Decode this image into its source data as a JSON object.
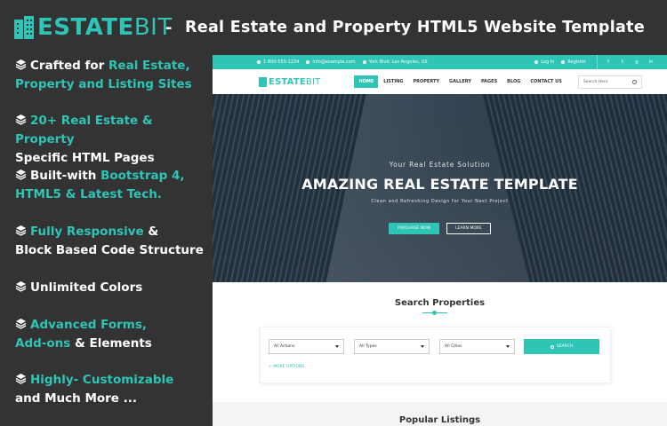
{
  "banner": {
    "brand_part1": "ESTATE",
    "brand_part2": "BIT",
    "dash": "-",
    "title": "Real Estate and Property HTML5 Website Template"
  },
  "features": [
    {
      "icon": "layers-icon",
      "parts": [
        {
          "text": "Crafted for ",
          "hl": false
        },
        {
          "text": "Real Estate,",
          "hl": true
        }
      ],
      "line2": [
        {
          "text": "Property and Listing Sites",
          "hl": true
        }
      ]
    },
    {
      "icon": "layers-icon",
      "parts": [
        {
          "text": "20+ Real Estate & Property",
          "hl": true
        }
      ],
      "line2": [
        {
          "text": "Specific HTML Pages",
          "hl": false
        }
      ]
    },
    {
      "icon": "layers-icon",
      "parts": [
        {
          "text": "Built-with ",
          "hl": false
        },
        {
          "text": "Bootstrap 4,",
          "hl": true
        }
      ],
      "line2": [
        {
          "text": "HTML5 & Latest Tech.",
          "hl": true
        }
      ]
    },
    {
      "icon": "layers-icon",
      "parts": [
        {
          "text": "Fully Responsive",
          "hl": true
        },
        {
          "text": " &",
          "hl": false
        }
      ],
      "line2": [
        {
          "text": "Block Based Code Structure",
          "hl": false
        }
      ]
    },
    {
      "icon": "layers-icon",
      "parts": [
        {
          "text": "Unlimited Colors",
          "hl": false
        }
      ],
      "line2": []
    },
    {
      "icon": "layers-icon",
      "parts": [
        {
          "text": "Advanced Forms,",
          "hl": true
        }
      ],
      "line2": [
        {
          "text": "Add-ons",
          "hl": true
        },
        {
          "text": " & Elements",
          "hl": false
        }
      ]
    },
    {
      "icon": "layers-icon",
      "parts": [
        {
          "text": "Highly- Customizable",
          "hl": true
        }
      ],
      "line2": [
        {
          "text": "and Much More ...",
          "hl": false
        }
      ]
    }
  ],
  "mock": {
    "topbar": {
      "phone": "1-800-555-1234",
      "email": "info@example.com",
      "address": "York Blvd, Los Angeles, US",
      "login": "Log In",
      "register": "Register",
      "social": [
        "f",
        "t",
        "g",
        "in"
      ]
    },
    "nav": {
      "logo_part1": "ESTATE",
      "logo_part2": "BIT",
      "items": [
        "HOME",
        "LISTING",
        "PROPERTY",
        "GALLERY",
        "PAGES",
        "BLOG",
        "CONTACT US"
      ],
      "active_index": 0,
      "search_placeholder": "Search Here"
    },
    "hero": {
      "subtitle": "Your Real Estate Solution",
      "title": "AMAZING REAL ESTATE TEMPLATE",
      "tagline": "Clean and Refreshing Design for Your Next Project",
      "primary_button": "PURCHASE NOW",
      "secondary_button": "LEARN MORE"
    },
    "search": {
      "title": "Search Properties",
      "actions": "All Actions",
      "types": "All Types",
      "cities": "All Cities",
      "button": "SEARCH",
      "more_options": "+ MORE OPTIONS"
    },
    "popular_title": "Popular Listings"
  },
  "colors": {
    "accent": "#2ec4b6",
    "background": "#333333"
  }
}
